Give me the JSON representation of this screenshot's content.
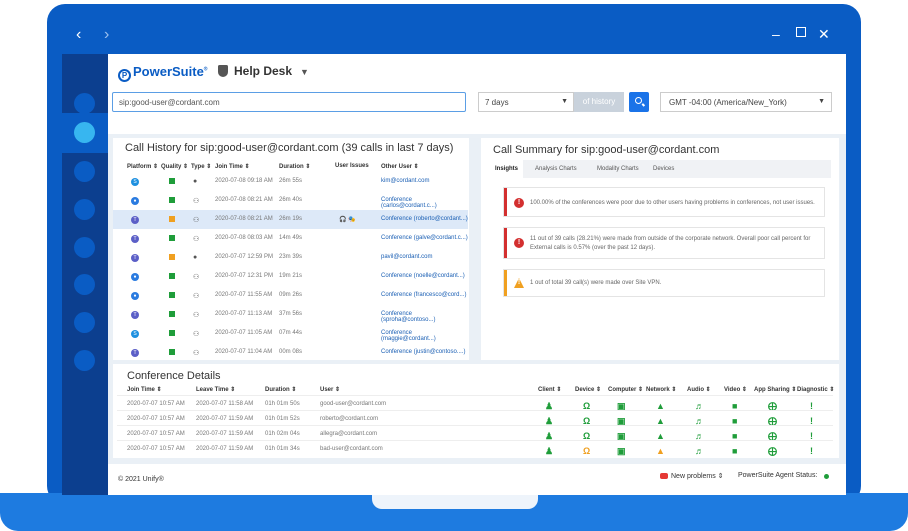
{
  "brand": {
    "name": "PowerSuite",
    "tm": "®",
    "section": "Help Desk"
  },
  "search": {
    "value": "sip:good-user@cordant.com"
  },
  "filters": {
    "days": "7 days",
    "of_history": "of history",
    "timezone": "GMT -04:00 (America/New_York)"
  },
  "call_history": {
    "title": "Call History for sip:good-user@cordant.com (39 calls in last 7 days)",
    "headers": [
      "Platform ⇕",
      "Quality ⇕",
      "Type ⇕",
      "Join Time ⇕",
      "Duration ⇕",
      "User Issues",
      "Other User ⇕"
    ],
    "rows": [
      {
        "platform": "skype",
        "quality": "green",
        "type": "person",
        "join": "2020-07-08 09:18 AM",
        "duration": "26m 55s",
        "issues": "",
        "other": "kim@cordant.com"
      },
      {
        "platform": "webex",
        "quality": "green",
        "type": "group",
        "join": "2020-07-08 08:21 AM",
        "duration": "26m 40s",
        "issues": "",
        "other": "Conference (carlos@cordant.c...)"
      },
      {
        "platform": "teams",
        "quality": "orange",
        "type": "group",
        "join": "2020-07-08 08:21 AM",
        "duration": "26m 19s",
        "issues": "🎧 🎭",
        "other": "Conference (roberto@cordant...)"
      },
      {
        "platform": "teams",
        "quality": "green",
        "type": "group",
        "join": "2020-07-08 08:03 AM",
        "duration": "14m 49s",
        "issues": "",
        "other": "Conference (galve@cordant.c...)"
      },
      {
        "platform": "teams",
        "quality": "orange",
        "type": "person",
        "join": "2020-07-07 12:59 PM",
        "duration": "23m 39s",
        "issues": "",
        "other": "pavil@cordant.com"
      },
      {
        "platform": "webex",
        "quality": "green",
        "type": "group",
        "join": "2020-07-07 12:31 PM",
        "duration": "19m 21s",
        "issues": "",
        "other": "Conference (noelle@cordant...)"
      },
      {
        "platform": "webex",
        "quality": "green",
        "type": "group",
        "join": "2020-07-07 11:55 AM",
        "duration": "09m 26s",
        "issues": "",
        "other": "Conference (francesco@cord...)"
      },
      {
        "platform": "teams",
        "quality": "green",
        "type": "group",
        "join": "2020-07-07 11:13 AM",
        "duration": "37m 56s",
        "issues": "",
        "other": "Conference (sproha@contoso...)"
      },
      {
        "platform": "skype",
        "quality": "green",
        "type": "group",
        "join": "2020-07-07 11:05 AM",
        "duration": "07m 44s",
        "issues": "",
        "other": "Conference (maggie@cordant...)"
      },
      {
        "platform": "teams",
        "quality": "green",
        "type": "group",
        "join": "2020-07-07 11:04 AM",
        "duration": "00m 08s",
        "issues": "",
        "other": "Conference (justin@contoso....)"
      }
    ]
  },
  "call_summary": {
    "title": "Call Summary for sip:good-user@cordant.com",
    "tabs": [
      "Insights",
      "Analysis Charts",
      "Modality Charts",
      "Devices"
    ],
    "insights": [
      {
        "level": "error",
        "text": "100.00% of the conferences were poor due to other users having problems in conferences, not user issues."
      },
      {
        "level": "error",
        "text": "11 out of 39 calls (28.21%) were made from outside of the corporate network. Overall poor call percent for External calls is 0.57% (over the past 12 days)."
      },
      {
        "level": "warning",
        "text": "1 out of total 39 call(s) were made over Site VPN."
      }
    ]
  },
  "conference_details": {
    "title": "Conference Details",
    "headers": [
      "Join Time ⇕",
      "Leave Time ⇕",
      "Duration ⇕",
      "User ⇕",
      "Client ⇕",
      "Device ⇕",
      "Computer ⇕",
      "Network ⇕",
      "Audio ⇕",
      "Video ⇕",
      "App Sharing ⇕",
      "Diagnostic ⇕"
    ],
    "rows": [
      {
        "join": "2020-07-07 10:57 AM",
        "leave": "2020-07-07 11:58 AM",
        "duration": "01h 01m 50s",
        "user": "good-user@cordant.com",
        "device_warn": false,
        "network_warn": false
      },
      {
        "join": "2020-07-07 10:57 AM",
        "leave": "2020-07-07 11:59 AM",
        "duration": "01h 01m 52s",
        "user": "roberto@cordant.com",
        "device_warn": false,
        "network_warn": false
      },
      {
        "join": "2020-07-07 10:57 AM",
        "leave": "2020-07-07 11:59 AM",
        "duration": "01h 02m 04s",
        "user": "allegra@cordant.com",
        "device_warn": false,
        "network_warn": false
      },
      {
        "join": "2020-07-07 10:57 AM",
        "leave": "2020-07-07 11:59 AM",
        "duration": "01h 01m 34s",
        "user": "bad-user@cordant.com",
        "device_warn": true,
        "network_warn": true
      }
    ]
  },
  "footer": {
    "copyright": "© 2021 Unify®",
    "new_problems": "New problems ⇕",
    "agent_status": "PowerSuite Agent Status:"
  },
  "colors": {
    "brand_blue": "#0a5cc4",
    "good": "#1f9d3a",
    "warn": "#f0a020",
    "error": "#d32f2f"
  }
}
